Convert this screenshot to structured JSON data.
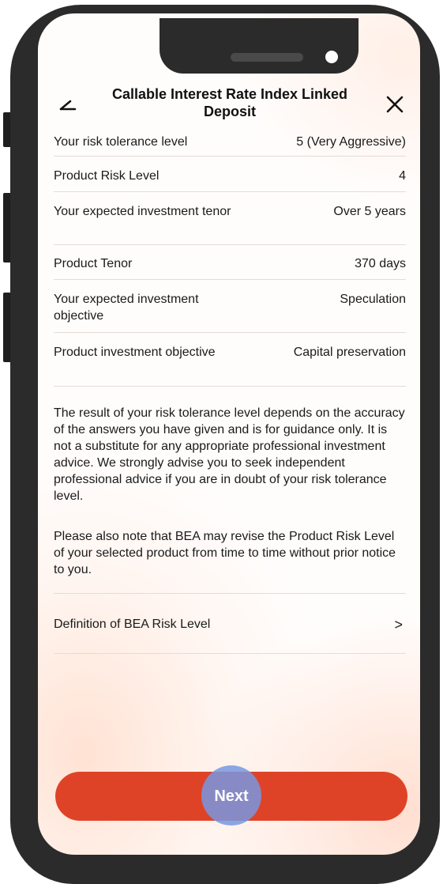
{
  "header": {
    "title": "Callable Interest Rate Index Linked Deposit",
    "back_icon": "back-arrow-icon",
    "close_icon": "close-icon"
  },
  "rows": [
    {
      "label": "Your risk tolerance level",
      "value": "5 (Very Aggressive)"
    },
    {
      "label": "Product Risk Level",
      "value": "4"
    },
    {
      "label": "Your expected investment tenor",
      "value": "Over 5 years"
    },
    {
      "label": "Product Tenor",
      "value": "370 days"
    },
    {
      "label": "Your expected investment objective",
      "value": "Speculation"
    },
    {
      "label": "Product investment objective",
      "value": "Capital preservation"
    }
  ],
  "disclaimer": {
    "paragraph1": "The result of your risk tolerance level depends on the accuracy of the answers you have given and is for guidance only. It is not a substitute for any appropriate professional investment advice. We strongly advise you to seek independent professional advice if you are in doubt of your risk tolerance level.",
    "paragraph2": "Please also note that BEA may revise the Product Risk Level of your selected product from time to time without prior notice to you."
  },
  "definition_link": {
    "label": "Definition of BEA Risk Level",
    "chevron": ">"
  },
  "next_button": {
    "label": "Next"
  },
  "colors": {
    "accent": "#df4327",
    "touch_indicator": "#7896e1"
  }
}
